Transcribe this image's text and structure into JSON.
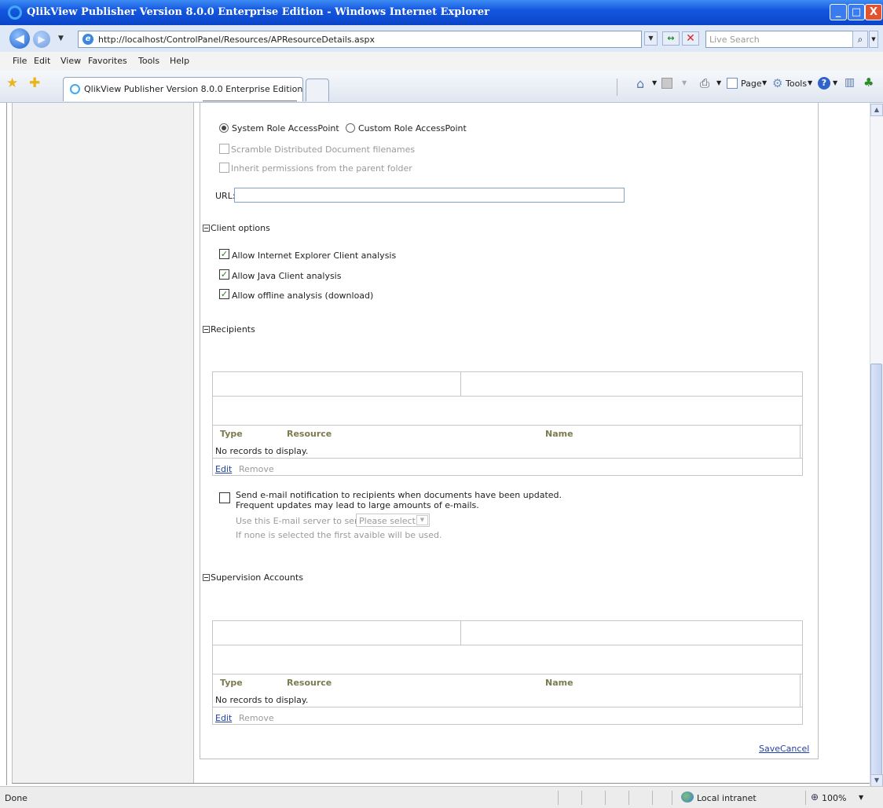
{
  "window": {
    "title": "QlikView Publisher Version 8.0.0 Enterprise Edition - Windows Internet Explorer",
    "minimize": "_",
    "maximize": "□",
    "close": "X"
  },
  "address_bar": {
    "url": "http://localhost/ControlPanel/Resources/APResourceDetails.aspx",
    "search_placeholder": "Live Search"
  },
  "menu": [
    "File",
    "Edit",
    "View",
    "Favorites",
    "Tools",
    "Help"
  ],
  "tabs": {
    "active_label": "QlikView Publisher Version 8.0.0 Enterprise Edition"
  },
  "command_bar": {
    "page": "Page",
    "tools": "Tools"
  },
  "access_point": {
    "radio_system": "System Role AccessPoint",
    "radio_custom": "Custom Role AccessPoint",
    "scramble_label": "Scramble Distributed Document filenames",
    "inherit_label": "Inherit permissions from the parent folder",
    "url_label": "URL:",
    "url_value": ""
  },
  "client_options": {
    "header": "Client options",
    "items": [
      {
        "label": "Allow Internet Explorer Client analysis",
        "checked": true
      },
      {
        "label": "Allow Java Client analysis",
        "checked": true
      },
      {
        "label": "Allow offline analysis (download)",
        "checked": true
      }
    ]
  },
  "recipients": {
    "header": "Recipients",
    "columns": [
      "Type",
      "Resource",
      "Name"
    ],
    "empty_text": "No records to display.",
    "edit": "Edit",
    "remove": "Remove"
  },
  "email": {
    "line1": "Send e-mail notification to recipients when documents have been updated.",
    "line2": "Frequent updates may lead to large amounts of e-mails.",
    "server_label": "Use this E-mail server to send:",
    "server_select": "Please select",
    "hint": "If none is selected the first avaible will be used."
  },
  "supervision": {
    "header": "Supervision Accounts",
    "columns": [
      "Type",
      "Resource",
      "Name"
    ],
    "empty_text": "No records to display.",
    "edit": "Edit",
    "remove": "Remove"
  },
  "footer_links": {
    "save": "Save",
    "cancel": "Cancel"
  },
  "status_bar": {
    "left": "Done",
    "zone": "Local intranet",
    "zoom": "100%"
  }
}
